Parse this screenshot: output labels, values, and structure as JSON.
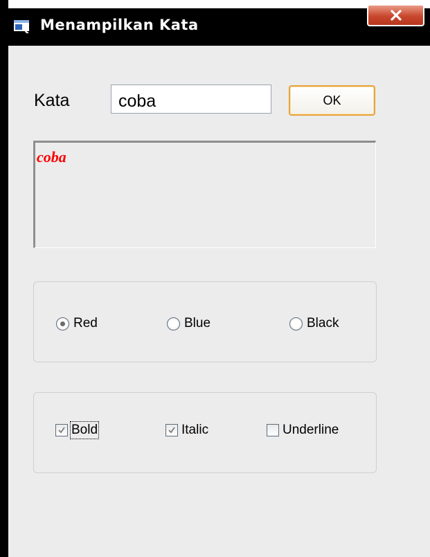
{
  "window": {
    "title": "Menampilkan Kata",
    "close_label": "x"
  },
  "form": {
    "kata_label": "Kata",
    "kata_value": "coba",
    "ok_label": "OK",
    "output_text": "coba",
    "output_color": "#ff0000"
  },
  "colors": {
    "options": [
      {
        "label": "Red",
        "checked": true
      },
      {
        "label": "Blue",
        "checked": false
      },
      {
        "label": "Black",
        "checked": false
      }
    ]
  },
  "styles": {
    "options": [
      {
        "label": "Bold",
        "checked": true
      },
      {
        "label": "Italic",
        "checked": true
      },
      {
        "label": "Underline",
        "checked": false
      }
    ]
  }
}
